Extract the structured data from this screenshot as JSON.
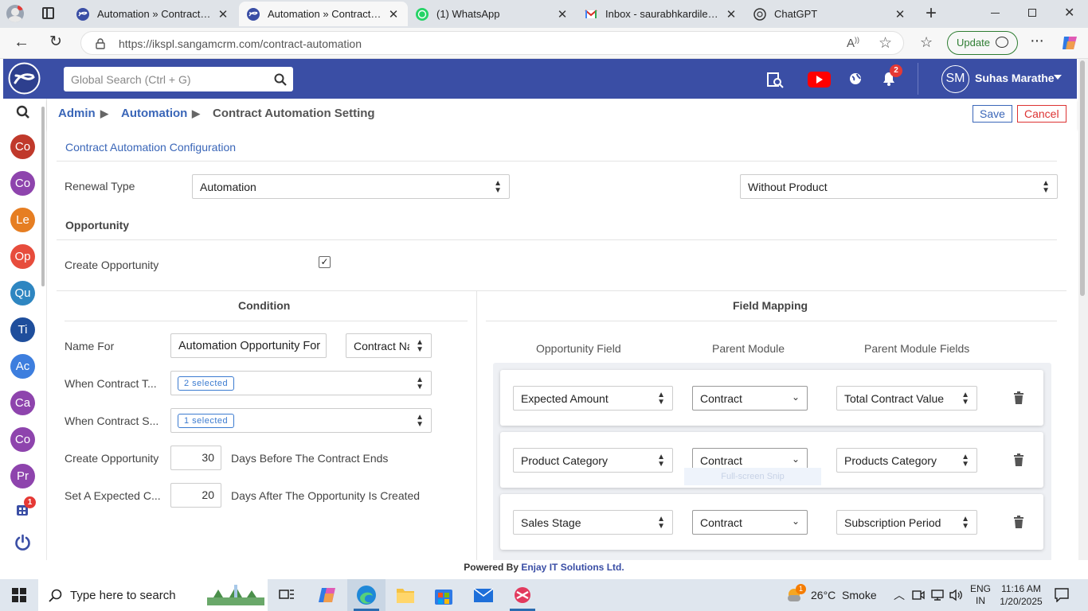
{
  "browser": {
    "tabs": [
      {
        "title": "Automation » Contract Auto"
      },
      {
        "title": "Automation » Contract Auto"
      },
      {
        "title": "(1) WhatsApp"
      },
      {
        "title": "Inbox - saurabhkardile@relia"
      },
      {
        "title": "ChatGPT"
      }
    ],
    "url": "https://ikspl.sangamcrm.com/contract-automation",
    "update_label": "Update"
  },
  "header": {
    "search_placeholder": "Global Search (Ctrl + G)",
    "notification_count": "2",
    "user_initials": "SM",
    "user_name": "Suhas Marathe"
  },
  "sidebar": {
    "items": [
      {
        "label": "Co",
        "color": "#c0392b"
      },
      {
        "label": "Co",
        "color": "#8e44ad"
      },
      {
        "label": "Le",
        "color": "#e67e22"
      },
      {
        "label": "Op",
        "color": "#e74c3c"
      },
      {
        "label": "Qu",
        "color": "#2e86c1"
      },
      {
        "label": "Ti",
        "color": "#1f4e9c"
      },
      {
        "label": "Ac",
        "color": "#3d7ede"
      },
      {
        "label": "Ca",
        "color": "#8e44ad"
      },
      {
        "label": "Co",
        "color": "#8e44ad"
      },
      {
        "label": "Pr",
        "color": "#8e44ad"
      }
    ],
    "app_badge": "1"
  },
  "breadcrumb": {
    "admin": "Admin",
    "automation": "Automation",
    "current": "Contract Automation Setting"
  },
  "actions": {
    "save": "Save",
    "cancel": "Cancel"
  },
  "config": {
    "tab": "Contract Automation Configuration",
    "renewal_label": "Renewal Type",
    "renewal_value": "Automation",
    "product_value": "Without Product",
    "opportunity_heading": "Opportunity",
    "create_opp_label": "Create Opportunity",
    "create_opp_checked": true
  },
  "condition": {
    "heading": "Condition",
    "rows": {
      "name_for_label": "Name For",
      "name_for_value": "Automation Opportunity For",
      "name_for_select": "Contract Na",
      "contract_type_label": "When Contract T...",
      "contract_type_value": "2 selected",
      "contract_status_label": "When Contract S...",
      "contract_status_value": "1 selected",
      "create_opp_label": "Create Opportunity",
      "create_opp_days": "30",
      "create_opp_suffix": "Days Before The Contract Ends",
      "expected_label": "Set A Expected C...",
      "expected_days": "20",
      "expected_suffix": "Days After The Opportunity Is Created"
    }
  },
  "mapping": {
    "heading": "Field Mapping",
    "col_opp": "Opportunity Field",
    "col_parent": "Parent Module",
    "col_fields": "Parent Module Fields",
    "rows": [
      {
        "opp": "Expected Amount",
        "parent": "Contract",
        "field": "Total Contract Value"
      },
      {
        "opp": "Product Category",
        "parent": "Contract",
        "field": "Products Category"
      },
      {
        "opp": "Sales Stage",
        "parent": "Contract",
        "field": "Subscription Period"
      }
    ],
    "snip_ghost": "Full-screen Snip"
  },
  "footer": {
    "prefix": "Powered By",
    "company": "Enjay IT Solutions Ltd."
  },
  "taskbar": {
    "search_placeholder": "Type here to search",
    "weather": "26°C  Smoke",
    "lang_top": "ENG",
    "lang_bottom": "IN",
    "time": "11:16 AM",
    "date": "1/20/2025",
    "weather_badge": "1"
  }
}
